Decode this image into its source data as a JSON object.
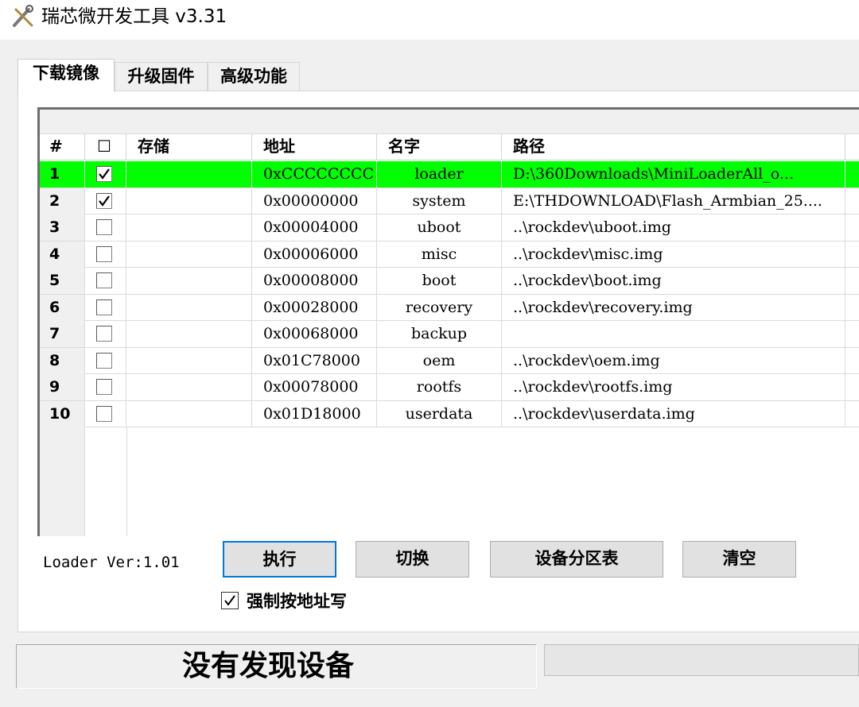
{
  "window": {
    "title": "瑞芯微开发工具 v3.31",
    "icon": "tools-icon"
  },
  "tabs": [
    {
      "label": "下载镜像",
      "active": true
    },
    {
      "label": "升级固件",
      "active": false
    },
    {
      "label": "高级功能",
      "active": false
    }
  ],
  "table": {
    "headers": {
      "num": "#",
      "check": "☐",
      "storage": "存储",
      "address": "地址",
      "name": "名字",
      "path": "路径"
    },
    "rows": [
      {
        "num": "1",
        "checked": true,
        "storage": "",
        "address": "0xCCCCCCCC",
        "name": "loader",
        "path": "D:\\360Downloads\\MiniLoaderAll_o...",
        "selected": true
      },
      {
        "num": "2",
        "checked": true,
        "storage": "",
        "address": "0x00000000",
        "name": "system",
        "path": "E:\\THDOWNLOAD\\Flash_Armbian_25....",
        "selected": false
      },
      {
        "num": "3",
        "checked": false,
        "storage": "",
        "address": "0x00004000",
        "name": "uboot",
        "path": "..\\rockdev\\uboot.img",
        "selected": false
      },
      {
        "num": "4",
        "checked": false,
        "storage": "",
        "address": "0x00006000",
        "name": "misc",
        "path": "..\\rockdev\\misc.img",
        "selected": false
      },
      {
        "num": "5",
        "checked": false,
        "storage": "",
        "address": "0x00008000",
        "name": "boot",
        "path": "..\\rockdev\\boot.img",
        "selected": false
      },
      {
        "num": "6",
        "checked": false,
        "storage": "",
        "address": "0x00028000",
        "name": "recovery",
        "path": "..\\rockdev\\recovery.img",
        "selected": false
      },
      {
        "num": "7",
        "checked": false,
        "storage": "",
        "address": "0x00068000",
        "name": "backup",
        "path": "",
        "selected": false
      },
      {
        "num": "8",
        "checked": false,
        "storage": "",
        "address": "0x01C78000",
        "name": "oem",
        "path": "..\\rockdev\\oem.img",
        "selected": false
      },
      {
        "num": "9",
        "checked": false,
        "storage": "",
        "address": "0x00078000",
        "name": "rootfs",
        "path": "..\\rockdev\\rootfs.img",
        "selected": false
      },
      {
        "num": "10",
        "checked": false,
        "storage": "",
        "address": "0x01D18000",
        "name": "userdata",
        "path": "..\\rockdev\\userdata.img",
        "selected": false
      }
    ]
  },
  "loader_version": "Loader Ver:1.01",
  "buttons": {
    "execute": "执行",
    "switch": "切换",
    "partition_table": "设备分区表",
    "clear": "清空"
  },
  "force_write": {
    "label": "强制按地址写",
    "checked": true
  },
  "status": {
    "message": "没有发现设备"
  },
  "colors": {
    "selected_row": "#00ff00",
    "primary_button_border": "#0078d7"
  }
}
